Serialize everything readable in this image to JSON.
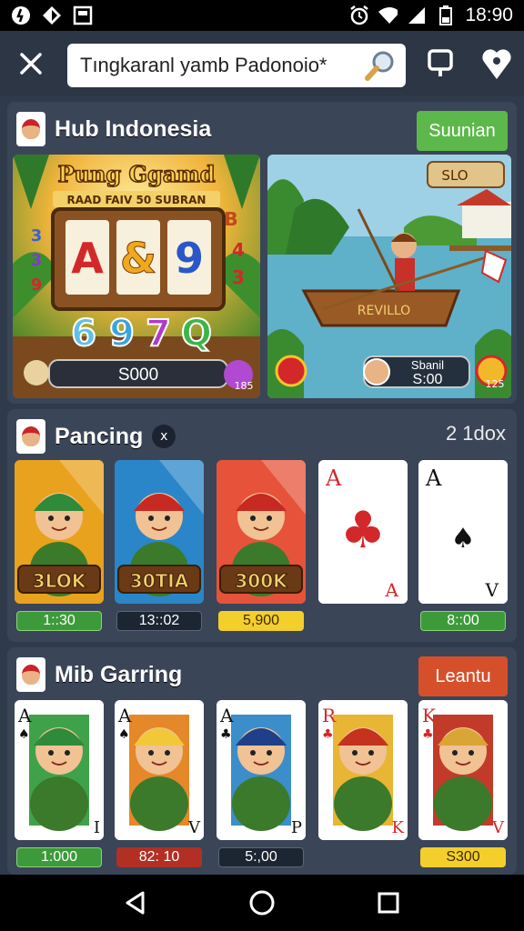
{
  "status_bar": {
    "time": "18:90"
  },
  "search": {
    "query": "Tıngkaranl yamb Padonoio*"
  },
  "panels": [
    {
      "title": "Hub Indonesia",
      "button": "Suunian",
      "banner_slot": {
        "title": "Pung Ggamd",
        "subtitle": "RAAD FAIV 50 SUBRAN",
        "reels": [
          "A",
          "&",
          "9"
        ],
        "side_left": [
          "3",
          "3",
          "9"
        ],
        "side_right": [
          "B",
          "4",
          "3"
        ],
        "symbols": [
          "6",
          "9",
          "7",
          "Q"
        ],
        "amount": "S000",
        "badge": "185"
      },
      "banner_fishing": {
        "sign": "SLO",
        "boat_label": "REVILLO",
        "score_label": "Sbanil",
        "score_value": "S:00",
        "badge": "125"
      }
    },
    {
      "title": "Pancing",
      "badge": "x",
      "count": "2 1dox",
      "cards": [
        {
          "kind": "hero",
          "label": "3LOK",
          "tag": "1::30",
          "tag_style": "green",
          "bg": "#e9a21d",
          "hat": "#2f8a3a"
        },
        {
          "kind": "hero",
          "label": "30TIA",
          "tag": "13::02",
          "tag_style": "dark",
          "bg": "#2a86c8",
          "hat": "#c62a22"
        },
        {
          "kind": "hero",
          "label": "300K",
          "tag": "5,900",
          "tag_style": "yellow",
          "bg": "#e6533a",
          "hat": "#c62a22"
        },
        {
          "kind": "playing",
          "rank": "A",
          "suit": "♣",
          "corner": "A",
          "tag": ""
        },
        {
          "kind": "playing",
          "rank": "A",
          "suit": "♠",
          "corner": "V",
          "tag": "8::00",
          "tag_style": "green"
        }
      ]
    },
    {
      "title": "Mib Garring",
      "button": "Leantu",
      "cards": [
        {
          "rank": "A",
          "suit": "♠",
          "corner": "I",
          "tag": "1:000",
          "tag_style": "green",
          "bg": "#3fa24a",
          "hat": "#2f8a3a"
        },
        {
          "rank": "A",
          "suit": "♠",
          "corner": "V",
          "tag": "82: 10",
          "tag_style": "red",
          "bg": "#e5882a",
          "hat": "#f2c83a"
        },
        {
          "rank": "A",
          "suit": "♣",
          "corner": "P",
          "tag": "5:,00",
          "tag_style": "dark",
          "bg": "#3b8ec9",
          "hat": "#1f3f8a"
        },
        {
          "rank": "R",
          "suit": "♣",
          "corner": "K",
          "tag": "",
          "bg": "#e8b534",
          "hat": "#c3331f"
        },
        {
          "rank": "K",
          "suit": "♣",
          "corner": "V",
          "tag": "S300",
          "tag_style": "yellow",
          "bg": "#c23b2a",
          "hat": "#d9a534"
        }
      ]
    }
  ],
  "colors": {
    "background": "#2f3a4b",
    "panel": "#3a4558",
    "accent_green": "#5cb84a",
    "accent_orange": "#d5502a"
  }
}
